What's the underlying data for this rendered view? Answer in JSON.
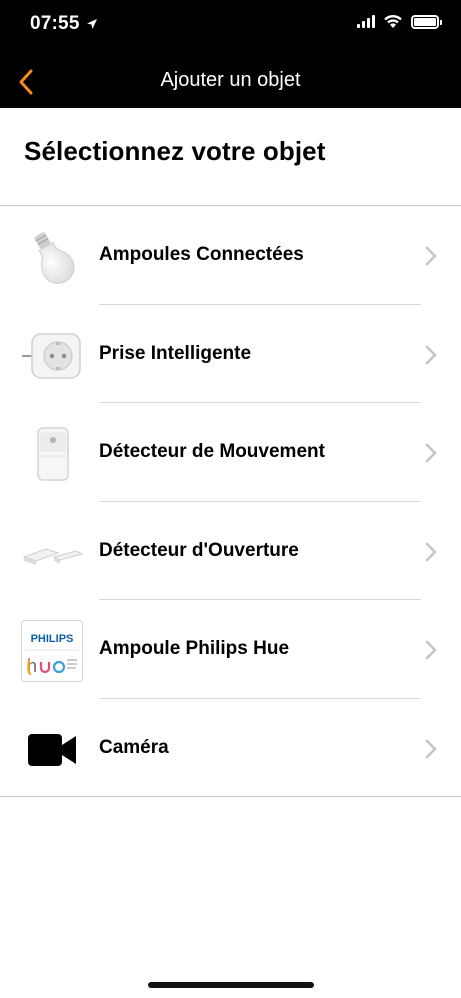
{
  "status_bar": {
    "time": "07:55"
  },
  "nav": {
    "title": "Ajouter un objet",
    "back_icon": "chevron-left-icon",
    "accent": "#f28c1e"
  },
  "section": {
    "title": "Sélectionnez votre objet"
  },
  "items": [
    {
      "label": "Ampoules Connectées",
      "icon": "light-bulb-icon"
    },
    {
      "label": "Prise Intelligente",
      "icon": "smart-plug-icon"
    },
    {
      "label": "Détecteur de Mouvement",
      "icon": "motion-sensor-icon"
    },
    {
      "label": "Détecteur d'Ouverture",
      "icon": "door-sensor-icon"
    },
    {
      "label": "Ampoule Philips Hue",
      "icon": "philips-hue-logo",
      "logo_text": "PHILIPS"
    },
    {
      "label": "Caméra",
      "icon": "video-camera-icon"
    }
  ]
}
